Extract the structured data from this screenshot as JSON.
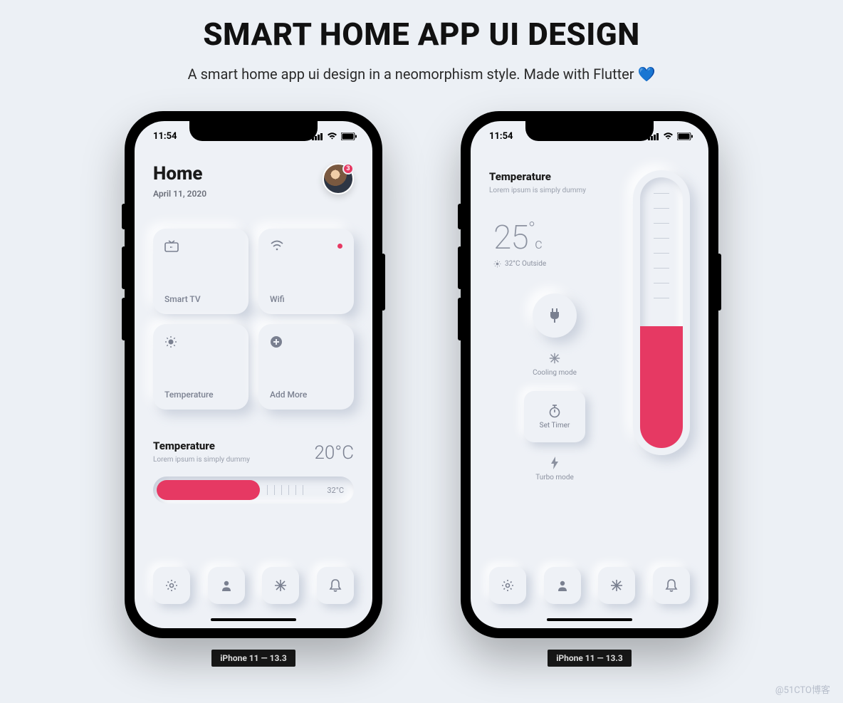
{
  "page": {
    "title": "SMART HOME APP UI DESIGN",
    "subtitle": "A smart home app ui design in a neomorphism style. Made with Flutter 💙"
  },
  "status": {
    "time": "11:54"
  },
  "screen1": {
    "title": "Home",
    "date": "April 11, 2020",
    "avatar_badge": "3",
    "tiles": [
      {
        "label": "Smart TV",
        "icon": "tv"
      },
      {
        "label": "Wifi",
        "icon": "wifi",
        "active": true
      },
      {
        "label": "Temperature",
        "icon": "sun"
      },
      {
        "label": "Add More",
        "icon": "plus"
      }
    ],
    "temp": {
      "title": "Temperature",
      "subtitle": "Lorem ipsum is simply dummy",
      "value": "20°C",
      "max": "32°C"
    }
  },
  "screen2": {
    "title": "Temperature",
    "subtitle": "Lorem ipsum is simply dummy",
    "value": "25",
    "unit": "c",
    "outside": "32°C Outside",
    "cooling": "Cooling mode",
    "timer": "Set Timer",
    "turbo": "Turbo mode"
  },
  "device_label": "iPhone 11 — 13.3",
  "watermark": "@51CTO博客"
}
